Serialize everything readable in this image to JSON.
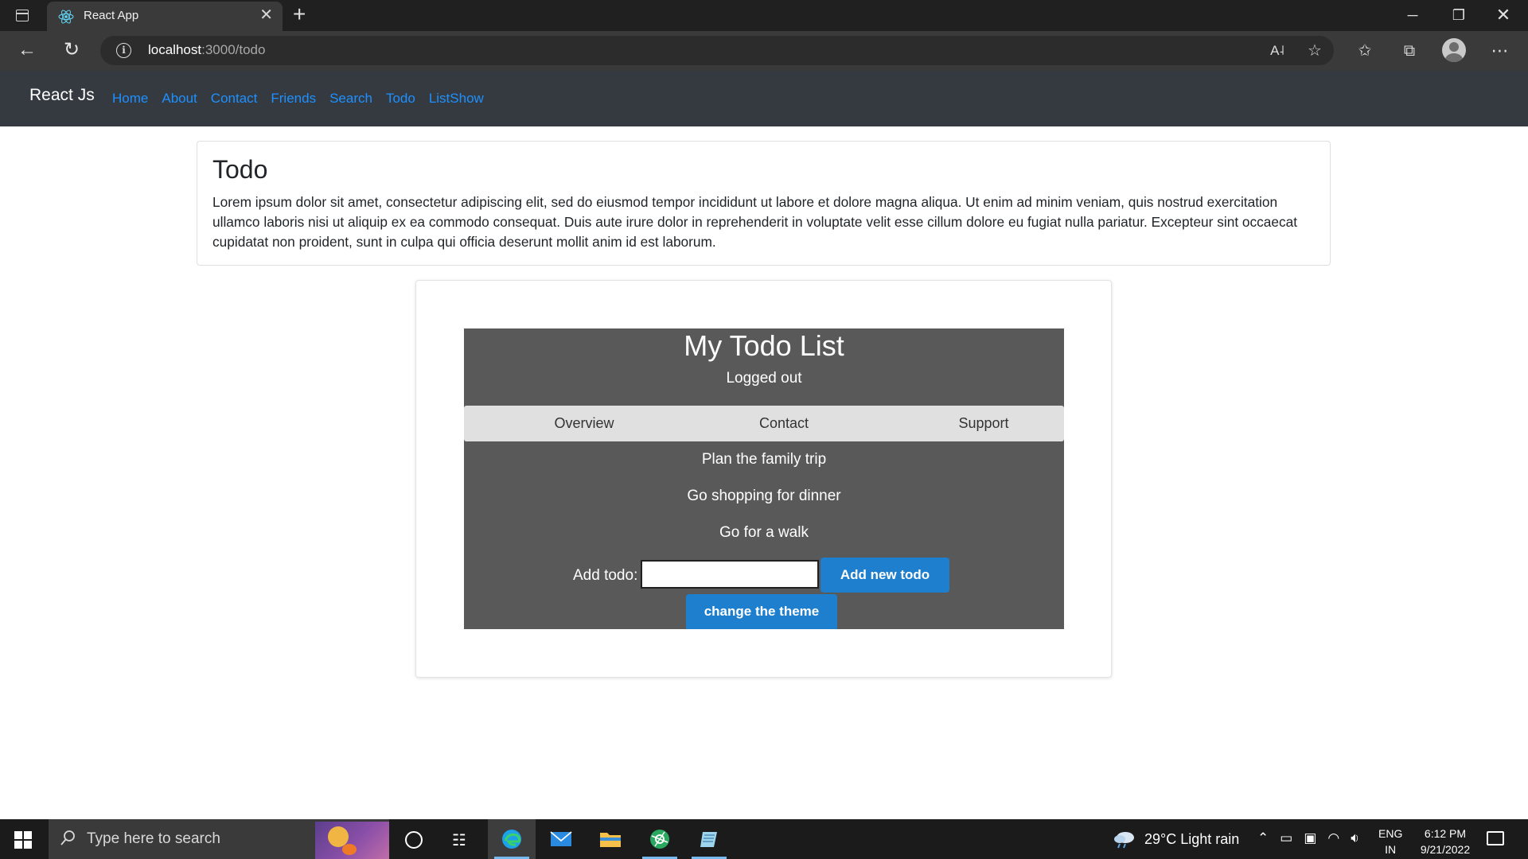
{
  "browser": {
    "tab_title": "React App",
    "tab_close": "✕",
    "new_tab": "+",
    "url_host": "localhost",
    "url_path": ":3000/todo",
    "window_controls": {
      "minimize": "─",
      "maximize": "❐",
      "close": "✕"
    },
    "toolbar_icons": [
      "read-aloud-icon",
      "add-favorite-icon",
      "favorites-icon",
      "collections-icon",
      "profile-icon",
      "more-icon"
    ]
  },
  "navbar": {
    "brand": "React Js",
    "links": [
      "Home",
      "About",
      "Contact",
      "Friends",
      "Search",
      "Todo",
      "ListShow"
    ],
    "link_color": "#1e90ff",
    "bg_color": "#343a40"
  },
  "card": {
    "title": "Todo",
    "text": "Lorem ipsum dolor sit amet, consectetur adipiscing elit, sed do eiusmod tempor incididunt ut labore et dolore magna aliqua. Ut enim ad minim veniam, quis nostrud exercitation ullamco laboris nisi ut aliquip ex ea commodo consequat. Duis aute irure dolor in reprehenderit in voluptate velit esse cillum dolore eu fugiat nulla pariatur. Excepteur sint occaecat cupidatat non proident, sunt in culpa qui officia deserunt mollit anim id est laborum."
  },
  "todo": {
    "title": "My Todo List",
    "status": "Logged out",
    "tabs": [
      "Overview",
      "Contact",
      "Support"
    ],
    "items": [
      "Plan the family trip",
      "Go shopping for dinner",
      "Go for a walk"
    ],
    "add_label": "Add todo:",
    "add_input_value": "",
    "add_button": "Add new todo",
    "theme_button": "change the theme",
    "panel_color": "#595959",
    "button_color": "#1e7fcf"
  },
  "taskbar": {
    "search_placeholder": "Type here to search",
    "weather": "29°C  Light rain",
    "lang_top": "ENG",
    "lang_bottom": "IN",
    "time": "6:12 PM",
    "date": "9/21/2022"
  }
}
